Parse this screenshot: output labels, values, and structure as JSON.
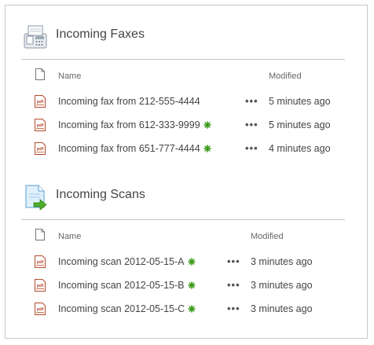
{
  "faxes": {
    "title": "Incoming Faxes",
    "columns": {
      "name": "Name",
      "modified": "Modified"
    },
    "rows": [
      {
        "name": "Incoming fax from 212-555-4444",
        "modified": "5 minutes ago",
        "is_new": false
      },
      {
        "name": "Incoming fax from 612-333-9999",
        "modified": "5 minutes ago",
        "is_new": true
      },
      {
        "name": "Incoming fax from 651-777-4444",
        "modified": "4 minutes ago",
        "is_new": true
      }
    ]
  },
  "scans": {
    "title": "Incoming Scans",
    "columns": {
      "name": "Name",
      "modified": "Modified"
    },
    "rows": [
      {
        "name": "Incoming scan 2012-05-15-A",
        "modified": "3 minutes ago",
        "is_new": true
      },
      {
        "name": "Incoming scan 2012-05-15-B",
        "modified": "3 minutes ago",
        "is_new": true
      },
      {
        "name": "Incoming scan 2012-05-15-C",
        "modified": "3 minutes ago",
        "is_new": true
      }
    ]
  },
  "icons": {
    "section_faxes": "fax-machine-icon",
    "section_scans": "scanned-document-icon",
    "row": "pdf-file-icon",
    "new": "new-item-icon",
    "column": "document-icon",
    "more": "ellipsis-icon"
  },
  "colors": {
    "pdf": "#b54a2c",
    "new": "#3a9a1a"
  }
}
